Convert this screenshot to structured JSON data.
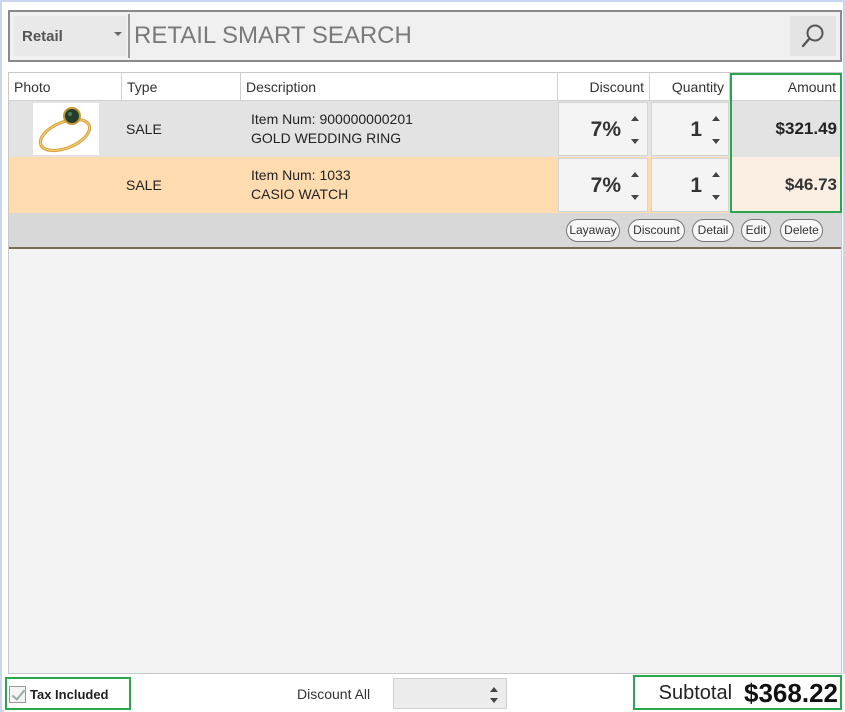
{
  "search": {
    "mode": "Retail",
    "placeholder": "RETAIL SMART SEARCH"
  },
  "table": {
    "columns": [
      "Photo",
      "Type",
      "Description",
      "Discount",
      "Quantity",
      "Amount"
    ],
    "rows": [
      {
        "photo": "ring-image",
        "type": "SALE",
        "item_num": "Item Num: 900000000201",
        "name": "GOLD WEDDING RING",
        "discount": "7%",
        "quantity": "1",
        "amount": "$321.49"
      },
      {
        "photo": "",
        "type": "SALE",
        "item_num": "Item Num: 1033",
        "name": "CASIO WATCH",
        "discount": "7%",
        "quantity": "1",
        "amount": "$46.73"
      }
    ],
    "actions": [
      "Layaway",
      "Discount",
      "Detail",
      "Edit",
      "Delete"
    ]
  },
  "footer": {
    "tax_included_label": "Tax Included",
    "tax_included_checked": true,
    "discount_all_label": "Discount All",
    "subtotal_label": "Subtotal",
    "subtotal_value": "$368.22"
  },
  "colors": {
    "highlight": "#2aa64f",
    "selected_row": "#ffdcb0",
    "row": "#e3e3e3"
  },
  "icons": {
    "search": "search-icon",
    "spin": "spinner-arrows-icon",
    "dropdown": "chevron-down-icon",
    "check": "checkmark-icon"
  }
}
